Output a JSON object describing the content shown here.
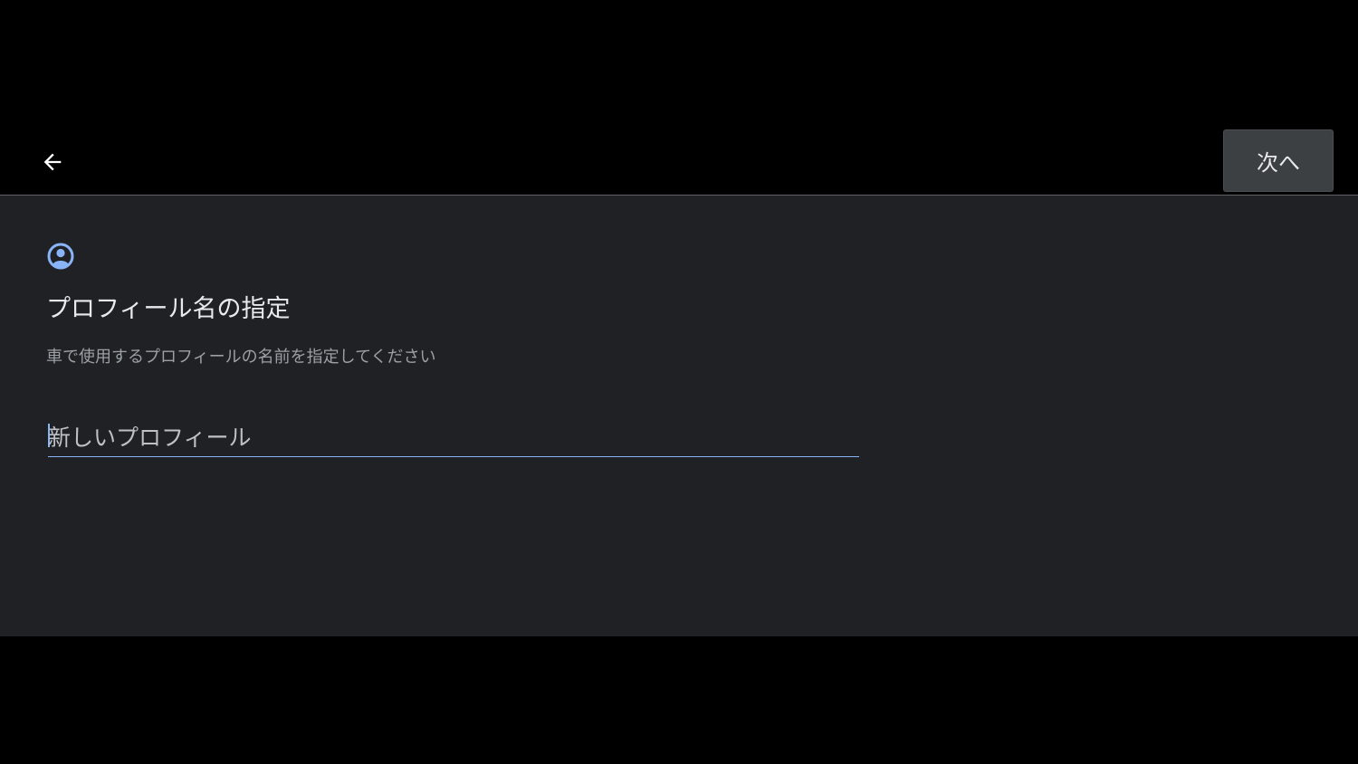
{
  "header": {
    "back_icon": "arrow-back-icon",
    "next_label": "次へ"
  },
  "main": {
    "icon": "account-circle-icon",
    "title": "プロフィール名の指定",
    "subtitle": "車で使用するプロフィールの名前を指定してください",
    "name_input": {
      "value": "",
      "placeholder": "新しいプロフィール"
    }
  },
  "colors": {
    "background": "#000000",
    "content_background": "#202124",
    "accent": "#8ab4f8",
    "button_background": "#3c4043",
    "title_text": "#e8eaed",
    "subtitle_text": "#9aa0a6"
  }
}
